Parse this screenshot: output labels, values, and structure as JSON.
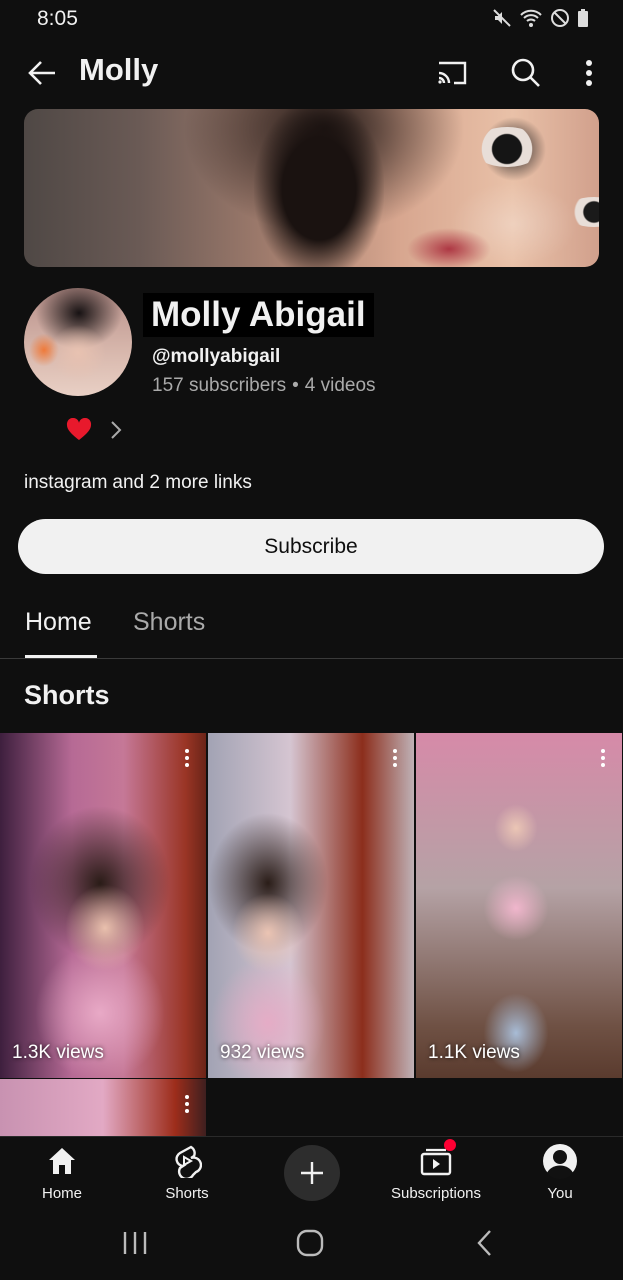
{
  "status_bar": {
    "time": "8:05"
  },
  "topbar": {
    "title": "Molly"
  },
  "channel": {
    "name": "Molly Abigail",
    "handle": "@mollyabigail",
    "subscribers": "157 subscribers",
    "separator": "•",
    "videos": "4 videos",
    "links_text": "instagram",
    "links_more": "and 2 more links"
  },
  "subscribe_label": "Subscribe",
  "tabs": [
    {
      "label": "Home",
      "active": true
    },
    {
      "label": "Shorts",
      "active": false
    }
  ],
  "section_title": "Shorts",
  "shorts": [
    {
      "views": "1.3K views"
    },
    {
      "views": "932 views"
    },
    {
      "views": "1.1K views"
    }
  ],
  "bottom_nav": {
    "home": "Home",
    "shorts": "Shorts",
    "subscriptions": "Subscriptions",
    "you": "You"
  },
  "colors": {
    "background": "#0f0f0f",
    "text": "#f1f1f1",
    "muted": "#aaaaaa",
    "heart": "#e8192c",
    "notification": "#ff0033"
  }
}
